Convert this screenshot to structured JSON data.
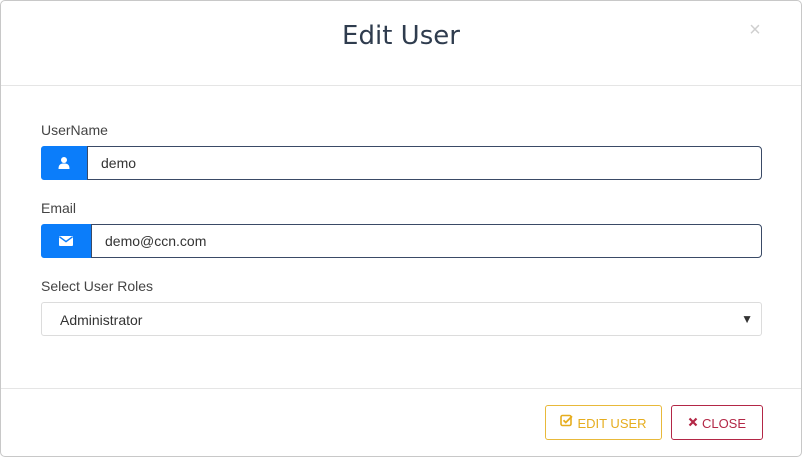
{
  "modal": {
    "title": "Edit User",
    "close_symbol": "×"
  },
  "form": {
    "username": {
      "label": "UserName",
      "value": "demo",
      "icon": "user-icon"
    },
    "email": {
      "label": "Email",
      "value": "demo@ccn.com",
      "icon": "envelope-icon"
    },
    "roles": {
      "label": "Select User Roles",
      "selected": "Administrator",
      "arrow": "▼"
    }
  },
  "footer": {
    "edit_label": "EDIT USER",
    "close_label": "CLOSE"
  },
  "colors": {
    "addon_blue": "#0b7dfa",
    "edit_yellow": "#e6ad1e",
    "close_red": "#b32746",
    "title_text": "#2f3c4e"
  }
}
